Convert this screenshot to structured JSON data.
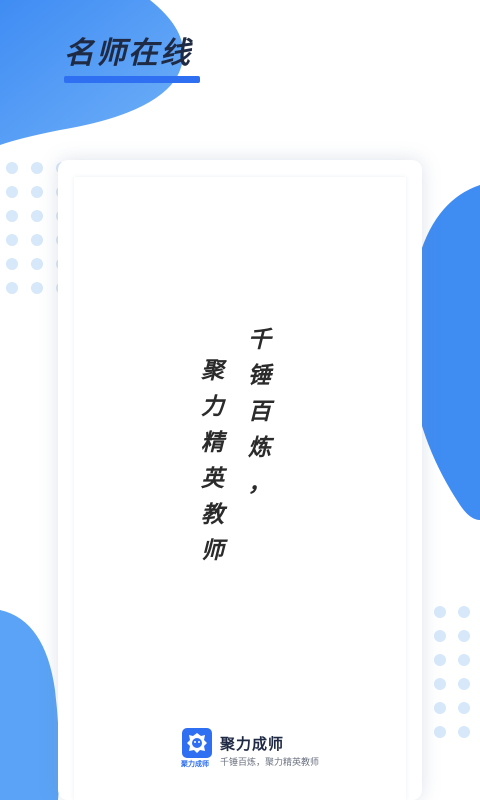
{
  "header": {
    "title": "名师在线"
  },
  "poster": {
    "column_right": [
      "千",
      "锤",
      "百",
      "炼",
      "，"
    ],
    "column_left": [
      "聚",
      "力",
      "精",
      "英",
      "教",
      "师"
    ]
  },
  "brand": {
    "name": "聚力成师",
    "logo_caption": "聚力成师",
    "slogan": "千锤百炼，聚力精英教师"
  },
  "colors": {
    "accent": "#2f6ff2",
    "blob": "#4a93f5",
    "dots": "#d6e8f9"
  }
}
